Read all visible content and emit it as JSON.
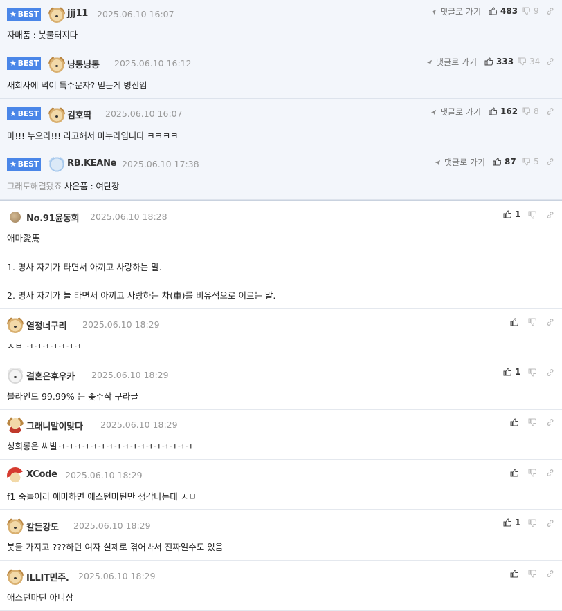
{
  "best_label": "BEST",
  "reply_label": "댓글로 가기",
  "best_comments": [
    {
      "nick": "jjj11",
      "date": "2025.06.10 16:07",
      "text": "자매품 : 붓물터지다",
      "up": "483",
      "down": "9",
      "avatar": "dog-icon"
    },
    {
      "nick": "냥동냥동",
      "date": "2025.06.10 16:12",
      "text": "새회사에 넉이 특수문자? 믿는게 병신임",
      "up": "333",
      "down": "34",
      "avatar": "dog-icon"
    },
    {
      "nick": "김호딱",
      "date": "2025.06.10 16:07",
      "text": "마!!! 누으라!!! 라고해서 마누라입니다 ㅋㅋㅋㅋ",
      "up": "162",
      "down": "8",
      "avatar": "dog-icon"
    },
    {
      "nick": "RB.KEANe",
      "date": "2025.06.10 17:38",
      "text_grey": "그래도해결됐죠",
      "text": " 사은품 : 여단장",
      "up": "87",
      "down": "5",
      "avatar": "bear-icon"
    }
  ],
  "comments": [
    {
      "nick": "No.91윤동희",
      "date": "2025.06.10 18:28",
      "lines": [
        "애마愛馬",
        "1. 명사 자기가 타면서 아끼고 사랑하는 말.",
        "2. 명사 자기가 늘 타면서 아끼고 사랑하는 차(車)를 비유적으로 이르는 말."
      ],
      "up": "1",
      "avatar": "level-ball-icon"
    },
    {
      "nick": "열정너구리",
      "date": "2025.06.10 18:29",
      "lines": [
        "ㅅㅂ ㅋㅋㅋㅋㅋㅋㅋ"
      ],
      "up": "",
      "avatar": "dog-icon"
    },
    {
      "nick": "결혼은후우카",
      "date": "2025.06.10 18:29",
      "lines": [
        "블라인드 99.99% 는 좆주작 구라글"
      ],
      "up": "1",
      "avatar": "white-dog-icon"
    },
    {
      "nick": "그래니말이맞다",
      "date": "2025.06.10 18:29",
      "lines": [
        "성희롱은 씨발ㅋㅋㅋㅋㅋㅋㅋㅋㅋㅋㅋㅋㅋㅋㅋㅋㅋ"
      ],
      "up": "",
      "avatar": "red-dog-icon"
    },
    {
      "nick": "XCode",
      "date": "2025.06.10 18:29",
      "lines": [
        "f1 죽돌이라 애마하면 애스턴마틴만 생각나는데 ㅅㅂ"
      ],
      "up": "",
      "avatar": "santa-dog-icon"
    },
    {
      "nick": "칼든강도",
      "date": "2025.06.10 18:29",
      "lines": [
        "붓물 가지고 ???하던 여자 실제로 겪어봐서 진짜일수도 있음"
      ],
      "up": "1",
      "avatar": "dog-icon"
    },
    {
      "nick": "ILLIT민주.",
      "date": "2025.06.10 18:29",
      "lines": [
        "애스턴마틴 아니삼"
      ],
      "up": "",
      "avatar": "dog-icon"
    }
  ],
  "colors": {
    "best_badge": "#4a86e8",
    "best_bg": "#f3f6fb"
  }
}
